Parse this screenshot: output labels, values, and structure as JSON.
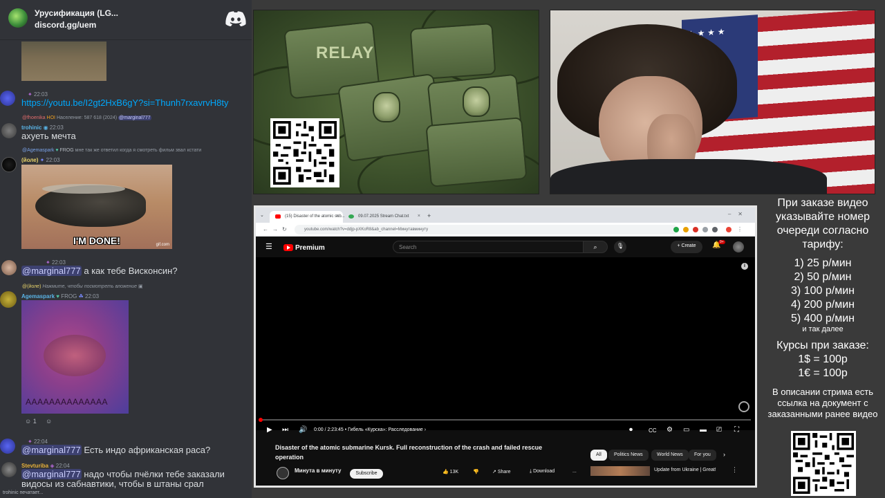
{
  "discord": {
    "server_name": "Урусификация (LG...",
    "server_invite": "discord.gg/uem",
    "messages": [
      {
        "time": "22:03",
        "text": "https://youtu.be/I2gt2HxB6gY?si=Thunh7rxavrvH8ty"
      },
      {
        "reply": "Население: 587 618 (2024)",
        "reply_mention": "@marginal777",
        "user": "trohinic",
        "time": "22:03",
        "text": "ахуеть мечта"
      },
      {
        "reply": "мне так же ответил когда я смотреть фильм звал кстати",
        "reply_user": "@Agemaspark",
        "reply_badge": "FROG",
        "user": "(йоле)",
        "time": "22:03",
        "image_caption": "I'M DONE!",
        "image_tag": "gif.com"
      },
      {
        "time": "22:03",
        "mention": "@marginal777",
        "text": " а как тебе Висконсин?"
      },
      {
        "reply_user": "@(йоле)",
        "reply": "Нажмите, чтобы посмотреть вложение",
        "user": "Agemaspark",
        "user_badge": "FROG",
        "time": "22:03",
        "image_caption": "AAAAAAAAAAAAAA",
        "reaction_count": "1"
      },
      {
        "time": "22:04",
        "mention": "@marginal777",
        "text": " Есть индо африканская раса?"
      },
      {
        "user": "Stevturiba",
        "time": "22:04",
        "mention": "@marginal777",
        "text": " надо чтобы пчёлки тебе заказали",
        "text2": "видосы из сабнавтики, чтобы в штаны срал"
      }
    ],
    "typing": "trohinic печатает..."
  },
  "relay_art": {
    "label": "RELAY"
  },
  "browser": {
    "tabs": [
      {
        "label": "(15) Disaster of the atomic sub...",
        "close": "×"
      },
      {
        "label": "09.07.2025 Stream Chat.txt",
        "close": "×"
      }
    ],
    "new_tab": "+",
    "url": "youtube.com/watch?v=ddjp-pXKoR8&ab_channel=Минутавминуту",
    "youtube": {
      "brand": "Premium",
      "search_placeholder": "Search",
      "create_label": "Create",
      "notif_badge": "9+",
      "time": "0:00 / 2:23:45",
      "chapter": "Гибель «Курска»: Расследование",
      "title": "Disaster of the atomic submarine Kursk. Full reconstruction of the crash and failed rescue operation",
      "channel": "Минута в минуту",
      "subscribe": "Subscribe",
      "likes": "13K",
      "share": "Share",
      "download": "Download",
      "more": "...",
      "chips": [
        "All",
        "Politics News",
        "World News",
        "For you"
      ],
      "recommended_title": "Update from Ukraine | Great!"
    }
  },
  "info_panel": {
    "heading": "При заказе видео указывайте номер очереди согласно тарифу:",
    "rates": [
      "1) 25 р/мин",
      "2) 50 р/мин",
      "3) 100 р/мин",
      "4) 200 р/мин",
      "5) 400 р/мин"
    ],
    "etc": "и так далее",
    "rates_heading": "Курсы при заказе:",
    "fx": [
      "1$ = 100р",
      "1€ = 100р"
    ],
    "doc_note": "В описании стрима есть ссылка на документ с заказанными ранее видео"
  }
}
